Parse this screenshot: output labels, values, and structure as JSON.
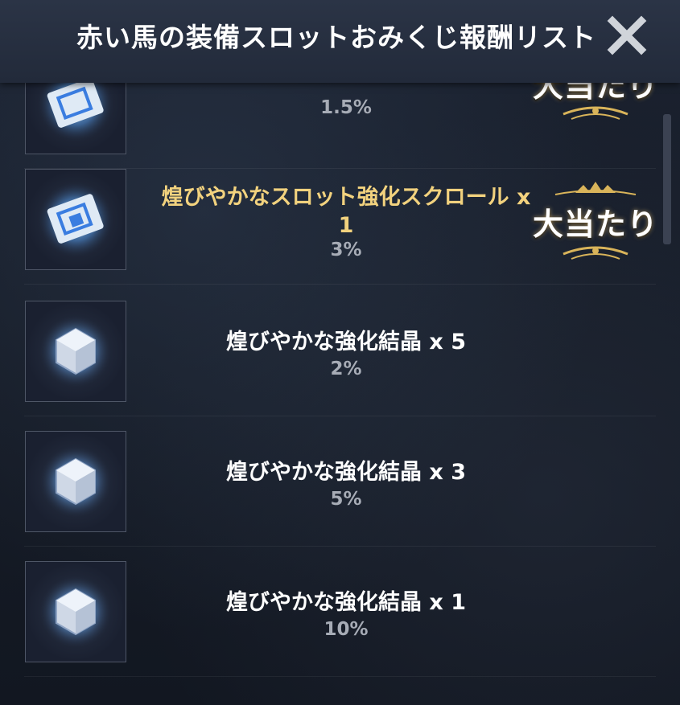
{
  "header": {
    "title": "赤い馬の装備スロットおみくじ報酬リスト"
  },
  "badge_text": "大当たり",
  "items": [
    {
      "name": "",
      "rate": "1.5%",
      "rare": true,
      "jackpot": true
    },
    {
      "name": "煌びやかなスロット強化スクロール x 1",
      "rate": "3%",
      "rare": true,
      "jackpot": true
    },
    {
      "name": "煌びやかな強化結晶 x 5",
      "rate": "2%",
      "rare": false,
      "jackpot": false
    },
    {
      "name": "煌びやかな強化結晶 x 3",
      "rate": "5%",
      "rare": false,
      "jackpot": false
    },
    {
      "name": "煌びやかな強化結晶 x 1",
      "rate": "10%",
      "rare": false,
      "jackpot": false
    }
  ],
  "colors": {
    "rare_name": "#f2d27e",
    "rate": "#a7acb6",
    "badge_gold": "#d9b45a"
  },
  "icons": {
    "scroll": "scroll-icon",
    "crystal": "crystal-icon",
    "close": "close-icon"
  }
}
